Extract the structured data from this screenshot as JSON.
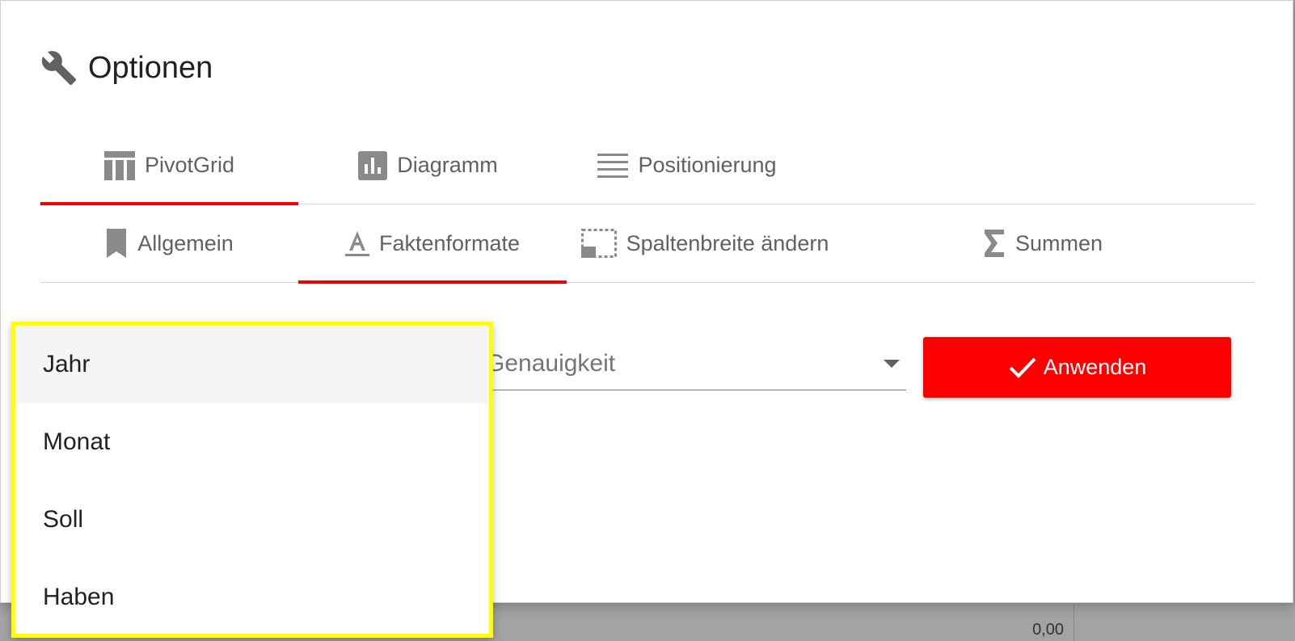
{
  "dialog": {
    "title": "Optionen"
  },
  "tabs_main": [
    {
      "label": "PivotGrid",
      "icon": "table-icon",
      "active": true
    },
    {
      "label": "Diagramm",
      "icon": "bar-chart-icon",
      "active": false
    },
    {
      "label": "Positionierung",
      "icon": "lines-icon",
      "active": false
    }
  ],
  "tabs_sub": [
    {
      "label": "Allgemein",
      "icon": "bookmark-icon",
      "active": false
    },
    {
      "label": "Faktenformate",
      "icon": "text-format-icon",
      "active": true
    },
    {
      "label": "Spaltenbreite ändern",
      "icon": "column-width-icon",
      "active": false
    },
    {
      "label": "Summen",
      "icon": "sigma-icon",
      "active": false
    }
  ],
  "form": {
    "precision_select": {
      "placeholder": "Genauigkeit"
    },
    "apply_label": "Anwenden"
  },
  "dropdown": {
    "options": [
      "Jahr",
      "Monat",
      "Soll",
      "Haben"
    ],
    "highlighted_index": 0
  },
  "background": {
    "cell_value": "0,00"
  },
  "colors": {
    "accent": "#ff0000",
    "highlight_border": "#ffff00"
  }
}
